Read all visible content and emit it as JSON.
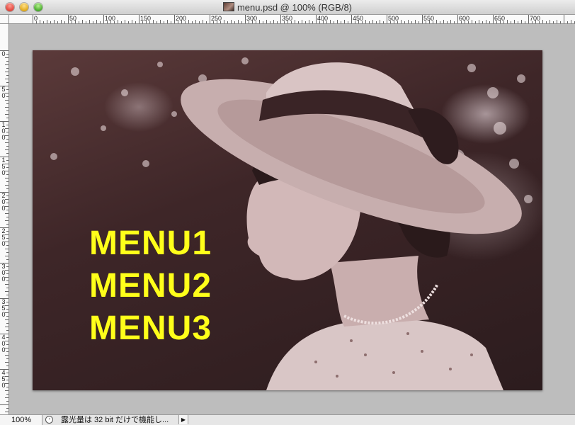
{
  "window": {
    "title": "menu.psd @ 100% (RGB/8)"
  },
  "ruler": {
    "top_labels": [
      "0",
      "50",
      "100",
      "150",
      "200",
      "250",
      "300",
      "350",
      "400",
      "450",
      "500",
      "550",
      "600",
      "650",
      "700"
    ],
    "left_labels": [
      "0",
      "50",
      "100",
      "150",
      "200",
      "250",
      "300",
      "350",
      "400",
      "450"
    ]
  },
  "canvas": {
    "menu_items": [
      {
        "label": "MENU1",
        "color": "#ffff1a"
      },
      {
        "label": "MENU2",
        "color": "#ffff1a"
      },
      {
        "label": "MENU3",
        "color": "#ffff1a"
      }
    ],
    "photo_description_icon": "sepia-portrait-image"
  },
  "status": {
    "zoom": "100%",
    "message": "露光量は 32 bit だけで機能し...",
    "arrow": "▶"
  }
}
